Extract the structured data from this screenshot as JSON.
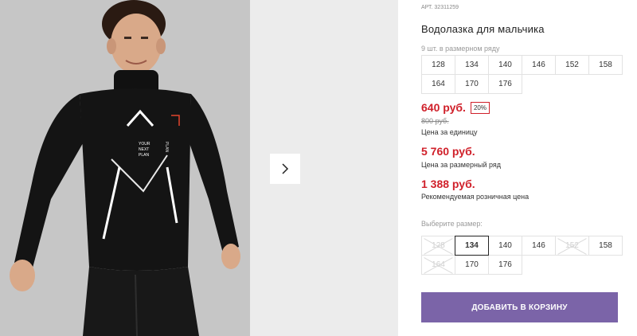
{
  "product": {
    "article": "АРТ. 32311259",
    "title": "Водолазка для мальчика",
    "pack_label": "9 шт. в размерном ряду",
    "pack_sizes": [
      "128",
      "134",
      "140",
      "146",
      "152",
      "158",
      "164",
      "170",
      "176"
    ],
    "price": "640 руб.",
    "discount": "20%",
    "old_price": "800 руб.",
    "unit_price_label": "Цена за единицу",
    "row_price": "5 760 руб.",
    "row_price_label": "Цена за размерный ряд",
    "retail_price": "1 388 руб.",
    "retail_price_label": "Рекомендуемая розничная цена"
  },
  "size_selector": {
    "label": "Выберите размер:",
    "selected": "134",
    "options": [
      {
        "value": "128",
        "available": false
      },
      {
        "value": "134",
        "available": true
      },
      {
        "value": "140",
        "available": true
      },
      {
        "value": "146",
        "available": true
      },
      {
        "value": "152",
        "available": false
      },
      {
        "value": "158",
        "available": true
      },
      {
        "value": "164",
        "available": false
      },
      {
        "value": "170",
        "available": true
      },
      {
        "value": "176",
        "available": true
      }
    ]
  },
  "gallery": {
    "next_icon": "chevron-right-icon",
    "shirt_print_lines": [
      "YOUR",
      "NEXT",
      "PLAN"
    ],
    "sleeve_print": "PLAN"
  },
  "actions": {
    "add_to_cart": "ДОБАВИТЬ В КОРЗИНУ"
  },
  "colors": {
    "price_red": "#d0202a",
    "button_purple": "#7b64a8"
  }
}
